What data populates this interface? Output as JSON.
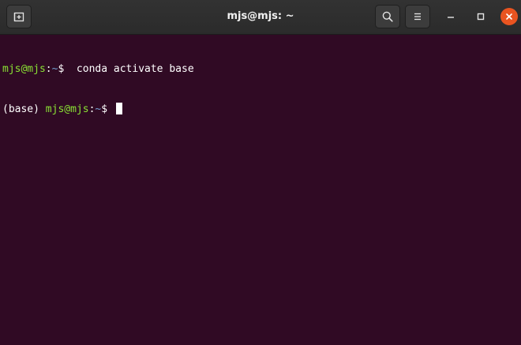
{
  "window": {
    "title": "mjs@mjs: ~"
  },
  "icons": {
    "new_tab": "new-tab-icon",
    "search": "search-icon",
    "menu": "hamburger-menu-icon",
    "minimize": "minimize-icon",
    "maximize": "maximize-icon",
    "close": "close-icon"
  },
  "colors": {
    "terminal_background": "#300a24",
    "prompt_user_host": "#8ae234",
    "prompt_path": "#729fcf",
    "close_button": "#e95420",
    "text": "#ffffff"
  },
  "terminal": {
    "lines": [
      {
        "prefix": "",
        "user_host": "mjs@mjs",
        "colon": ":",
        "path": "~",
        "dollar": "$",
        "command": "  conda activate base"
      },
      {
        "prefix": "(base) ",
        "user_host": "mjs@mjs",
        "colon": ":",
        "path": "~",
        "dollar": "$",
        "command": ""
      }
    ]
  }
}
